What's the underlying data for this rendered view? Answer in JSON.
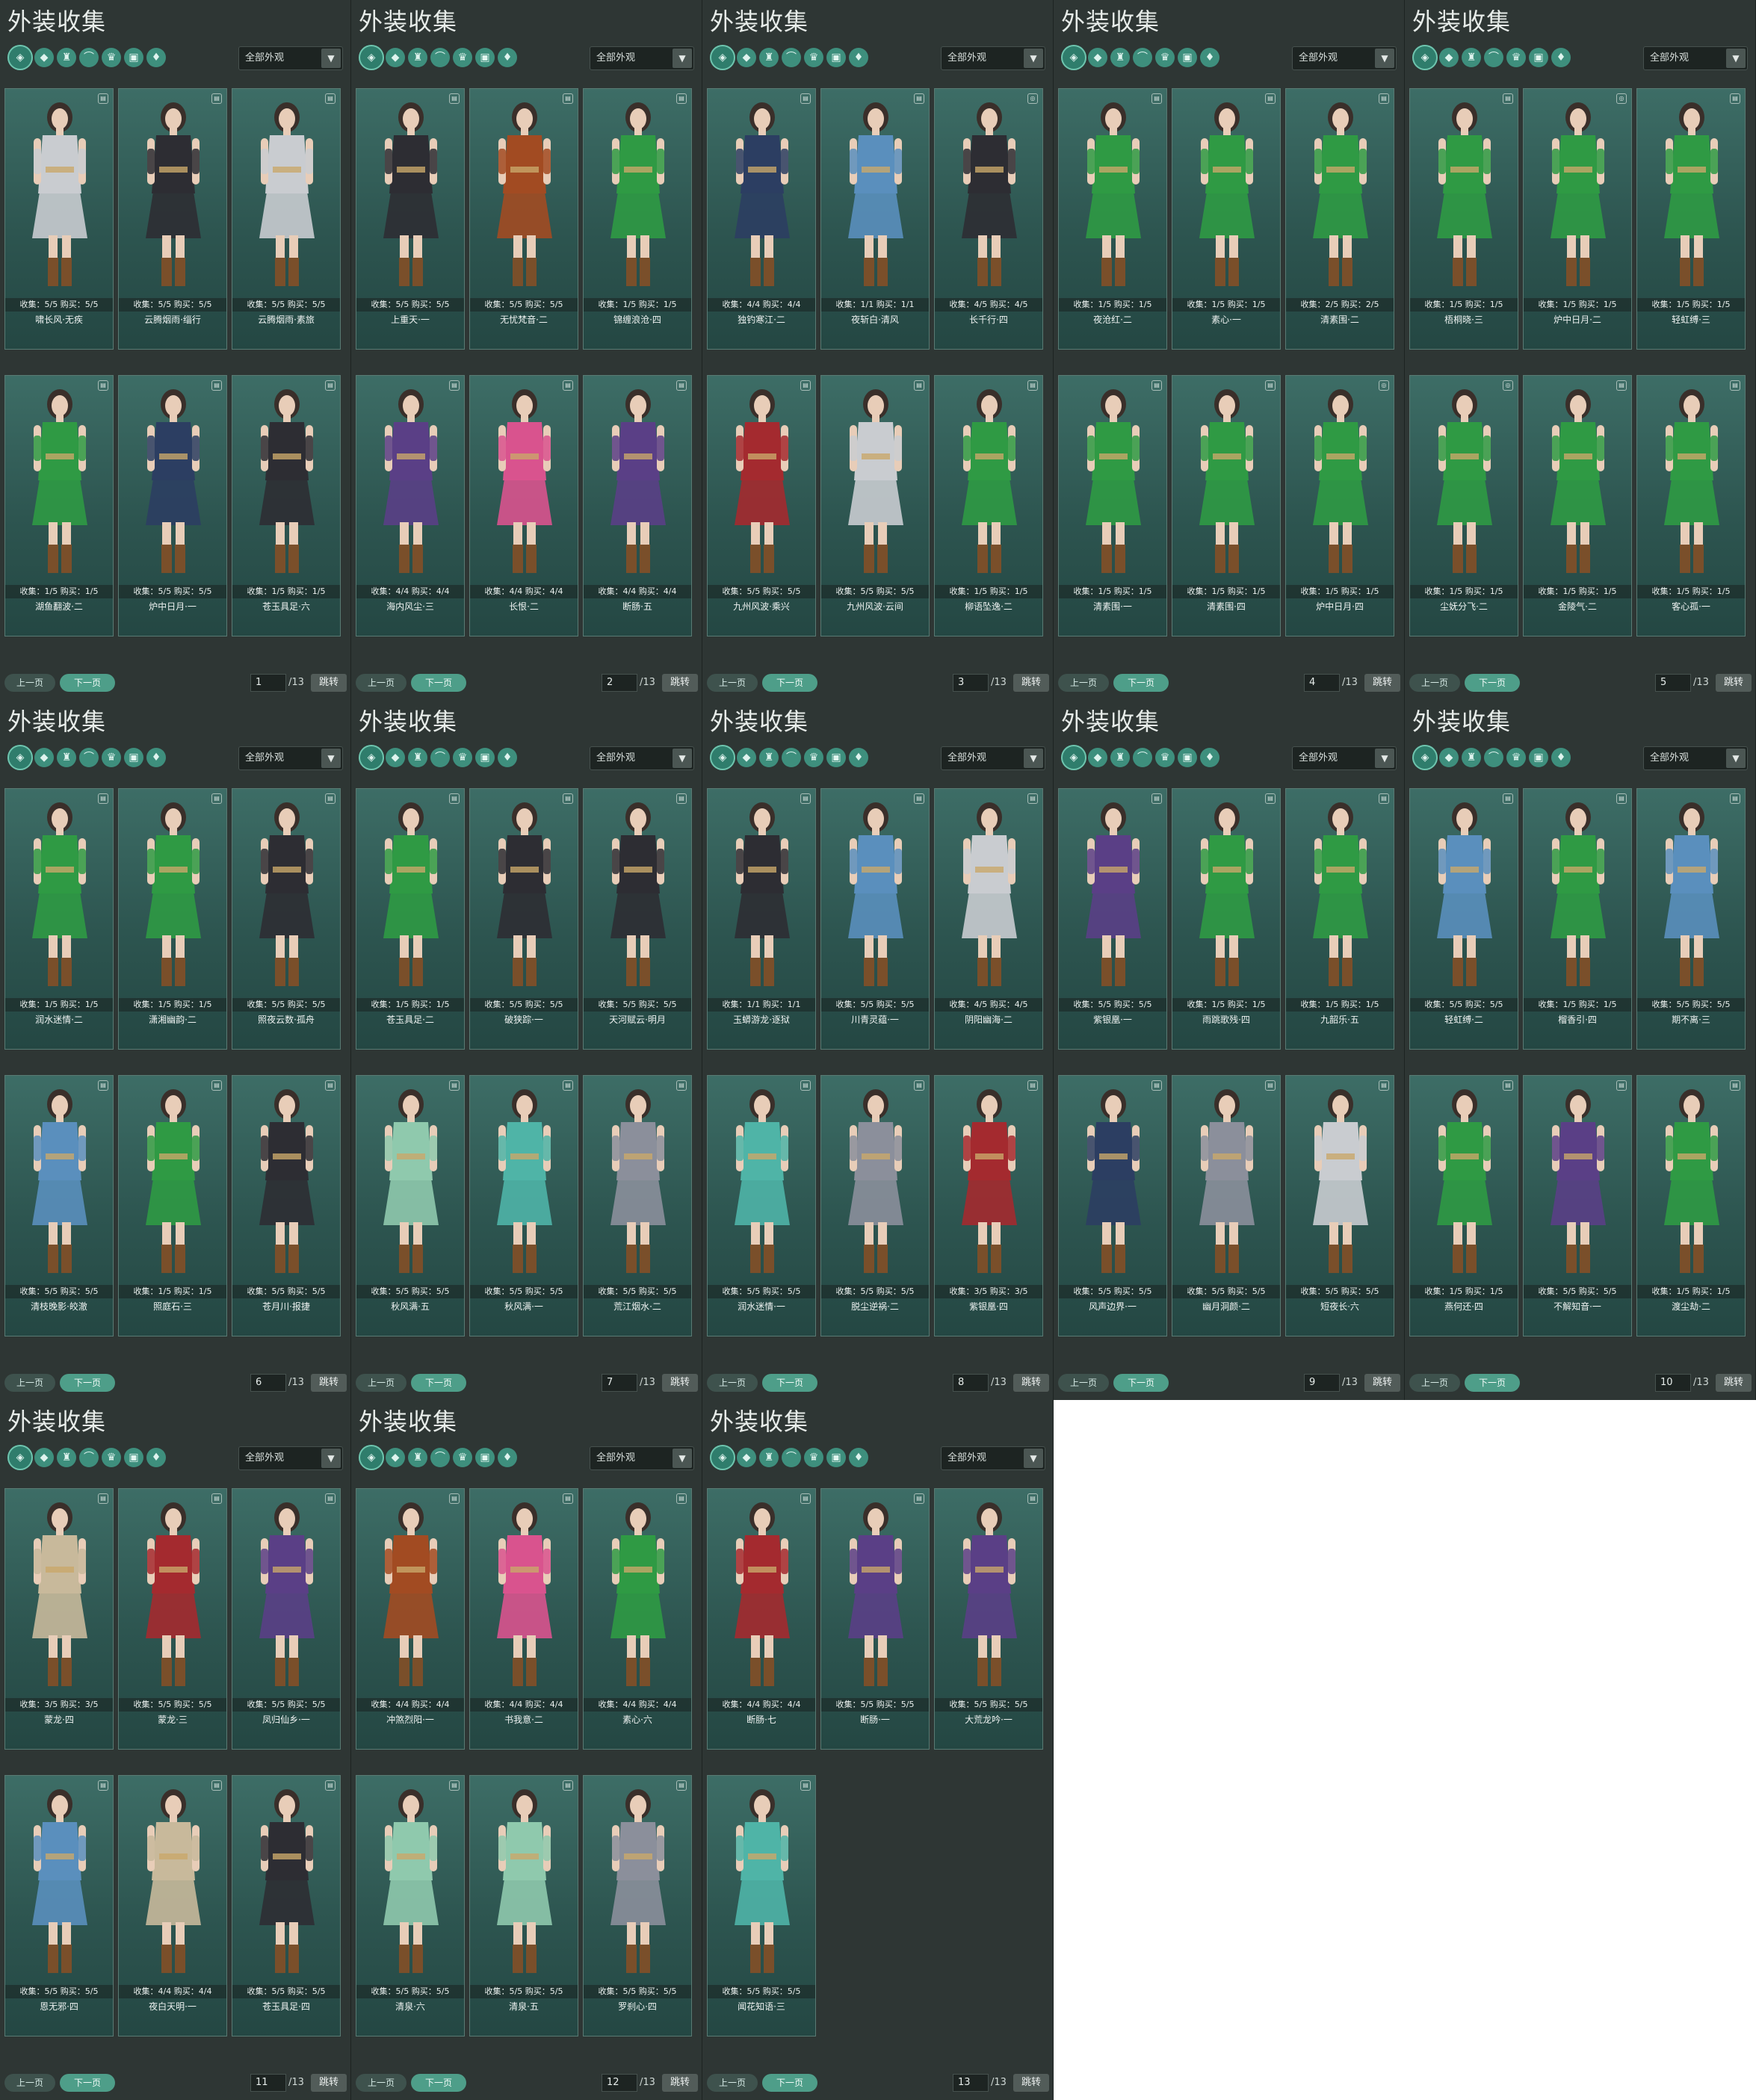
{
  "panel_title": "外装收集",
  "filter_label": "全部外观",
  "tab_icons": [
    "coin-tab-icon",
    "outfit-tab-icon",
    "robe-tab-icon",
    "shoes-tab-icon",
    "hair-tab-icon",
    "mask-tab-icon",
    "weapon-tab-icon"
  ],
  "prev_label": "上一页",
  "next_label": "下一页",
  "jump_label": "跳转",
  "total_pages": "/13",
  "collect_prefix": "收集",
  "buy_prefix": "购买",
  "panels": [
    {
      "page": "1",
      "cards": [
        {
          "name": "啸长风·无疾",
          "collect": "5/5",
          "buy": "5/5",
          "outfit": "white",
          "icon": "gift"
        },
        {
          "name": "云腾烟雨·缁行",
          "collect": "5/5",
          "buy": "5/5",
          "outfit": "dark",
          "icon": "gift"
        },
        {
          "name": "云腾烟雨·素旅",
          "collect": "5/5",
          "buy": "5/5",
          "outfit": "white",
          "icon": "gift"
        },
        {
          "name": "湖鱼翻波·二",
          "collect": "1/5",
          "buy": "1/5",
          "outfit": "green",
          "icon": "gift"
        },
        {
          "name": "炉中日月·一",
          "collect": "5/5",
          "buy": "5/5",
          "outfit": "navy",
          "icon": "gift"
        },
        {
          "name": "苍玉具足·六",
          "collect": "1/5",
          "buy": "1/5",
          "outfit": "dark",
          "icon": "gift"
        }
      ]
    },
    {
      "page": "2",
      "cards": [
        {
          "name": "上重天·一",
          "collect": "5/5",
          "buy": "5/5",
          "outfit": "dark",
          "icon": "gift"
        },
        {
          "name": "无忧梵音·二",
          "collect": "5/5",
          "buy": "5/5",
          "outfit": "orange",
          "icon": "gift"
        },
        {
          "name": "锦缠浪沧·四",
          "collect": "1/5",
          "buy": "1/5",
          "outfit": "green",
          "icon": "gift"
        },
        {
          "name": "海内风尘·三",
          "collect": "4/4",
          "buy": "4/4",
          "outfit": "purple",
          "icon": "gift"
        },
        {
          "name": "长恨·二",
          "collect": "4/4",
          "buy": "4/4",
          "outfit": "pink",
          "icon": "gift"
        },
        {
          "name": "断肠·五",
          "collect": "4/4",
          "buy": "4/4",
          "outfit": "purple",
          "icon": "gift"
        }
      ]
    },
    {
      "page": "3",
      "cards": [
        {
          "name": "独钓寒江·二",
          "collect": "4/4",
          "buy": "4/4",
          "outfit": "navy",
          "icon": "gift"
        },
        {
          "name": "夜斩白·清风",
          "collect": "1/1",
          "buy": "1/1",
          "outfit": "blue",
          "icon": "gift"
        },
        {
          "name": "长千行·四",
          "collect": "4/5",
          "buy": "4/5",
          "outfit": "dark",
          "icon": "lock"
        },
        {
          "name": "九州风波·乘兴",
          "collect": "5/5",
          "buy": "5/5",
          "outfit": "red",
          "icon": "gift"
        },
        {
          "name": "九州风波·云间",
          "collect": "5/5",
          "buy": "5/5",
          "outfit": "white",
          "icon": "gift"
        },
        {
          "name": "柳语坠逸·二",
          "collect": "1/5",
          "buy": "1/5",
          "outfit": "green",
          "icon": "gift"
        }
      ]
    },
    {
      "page": "4",
      "cards": [
        {
          "name": "夜沧红·二",
          "collect": "1/5",
          "buy": "1/5",
          "outfit": "green",
          "icon": "gift"
        },
        {
          "name": "素心·一",
          "collect": "1/5",
          "buy": "1/5",
          "outfit": "green",
          "icon": "gift"
        },
        {
          "name": "清素围·二",
          "collect": "2/5",
          "buy": "2/5",
          "outfit": "green",
          "icon": "gift"
        },
        {
          "name": "清素围·一",
          "collect": "1/5",
          "buy": "1/5",
          "outfit": "green",
          "icon": "gift"
        },
        {
          "name": "清素围·四",
          "collect": "1/5",
          "buy": "1/5",
          "outfit": "green",
          "icon": "gift"
        },
        {
          "name": "炉中日月·四",
          "collect": "1/5",
          "buy": "1/5",
          "outfit": "green",
          "icon": "lock"
        }
      ]
    },
    {
      "page": "5",
      "cards": [
        {
          "name": "梧桐晓·三",
          "collect": "1/5",
          "buy": "1/5",
          "outfit": "green",
          "icon": "gift"
        },
        {
          "name": "炉中日月·二",
          "collect": "1/5",
          "buy": "1/5",
          "outfit": "green",
          "icon": "lock"
        },
        {
          "name": "轻虹缚·三",
          "collect": "1/5",
          "buy": "1/5",
          "outfit": "green",
          "icon": "gift"
        },
        {
          "name": "尘妩分飞·二",
          "collect": "1/5",
          "buy": "1/5",
          "outfit": "green",
          "icon": "lock"
        },
        {
          "name": "金陵气·二",
          "collect": "1/5",
          "buy": "1/5",
          "outfit": "green",
          "icon": "gift"
        },
        {
          "name": "客心孤·一",
          "collect": "1/5",
          "buy": "1/5",
          "outfit": "green",
          "icon": "gift"
        }
      ]
    },
    {
      "page": "6",
      "cards": [
        {
          "name": "润水迷情·二",
          "collect": "1/5",
          "buy": "1/5",
          "outfit": "green",
          "icon": "gift"
        },
        {
          "name": "潇湘幽韵·二",
          "collect": "1/5",
          "buy": "1/5",
          "outfit": "green",
          "icon": "gift"
        },
        {
          "name": "照夜云数·孤舟",
          "collect": "5/5",
          "buy": "5/5",
          "outfit": "dark",
          "icon": "gift"
        },
        {
          "name": "清枝晚影·皎澈",
          "collect": "5/5",
          "buy": "5/5",
          "outfit": "blue",
          "icon": "gift"
        },
        {
          "name": "照庭石·三",
          "collect": "1/5",
          "buy": "1/5",
          "outfit": "green",
          "icon": "gift"
        },
        {
          "name": "苍月川·报捷",
          "collect": "5/5",
          "buy": "5/5",
          "outfit": "dark",
          "icon": "gift"
        }
      ]
    },
    {
      "page": "7",
      "cards": [
        {
          "name": "苍玉具足·二",
          "collect": "1/5",
          "buy": "1/5",
          "outfit": "green",
          "icon": "gift"
        },
        {
          "name": "破狭踪·一",
          "collect": "5/5",
          "buy": "5/5",
          "outfit": "dark",
          "icon": "gift"
        },
        {
          "name": "天河赋云·明月",
          "collect": "5/5",
          "buy": "5/5",
          "outfit": "dark",
          "icon": "gift"
        },
        {
          "name": "秋风满·五",
          "collect": "5/5",
          "buy": "5/5",
          "outfit": "mint",
          "icon": "gift"
        },
        {
          "name": "秋风满·一",
          "collect": "5/5",
          "buy": "5/5",
          "outfit": "teal",
          "icon": "gift"
        },
        {
          "name": "荒江烟水·二",
          "collect": "5/5",
          "buy": "5/5",
          "outfit": "grey",
          "icon": "gift"
        }
      ]
    },
    {
      "page": "8",
      "cards": [
        {
          "name": "玉蟒游龙·逐狱",
          "collect": "1/1",
          "buy": "1/1",
          "outfit": "dark",
          "icon": "gift"
        },
        {
          "name": "川青灵蕴·一",
          "collect": "5/5",
          "buy": "5/5",
          "outfit": "blue",
          "icon": "gift"
        },
        {
          "name": "阴阳幽海·二",
          "collect": "4/5",
          "buy": "4/5",
          "outfit": "white",
          "icon": "gift"
        },
        {
          "name": "润水迷情·一",
          "collect": "5/5",
          "buy": "5/5",
          "outfit": "teal",
          "icon": "gift"
        },
        {
          "name": "脱尘逆祸·二",
          "collect": "5/5",
          "buy": "5/5",
          "outfit": "grey",
          "icon": "gift"
        },
        {
          "name": "紫银凰·四",
          "collect": "3/5",
          "buy": "3/5",
          "outfit": "red",
          "icon": "gift"
        }
      ]
    },
    {
      "page": "9",
      "cards": [
        {
          "name": "紫银凰·一",
          "collect": "5/5",
          "buy": "5/5",
          "outfit": "purple",
          "icon": "gift"
        },
        {
          "name": "雨跳歌残·四",
          "collect": "1/5",
          "buy": "1/5",
          "outfit": "green",
          "icon": "gift"
        },
        {
          "name": "九韶乐·五",
          "collect": "1/5",
          "buy": "1/5",
          "outfit": "green",
          "icon": "gift"
        },
        {
          "name": "风声边界·一",
          "collect": "5/5",
          "buy": "5/5",
          "outfit": "navy",
          "icon": "gift"
        },
        {
          "name": "幽月洞颜·二",
          "collect": "5/5",
          "buy": "5/5",
          "outfit": "grey",
          "icon": "gift"
        },
        {
          "name": "短夜长·六",
          "collect": "5/5",
          "buy": "5/5",
          "outfit": "white",
          "icon": "gift"
        }
      ]
    },
    {
      "page": "10",
      "cards": [
        {
          "name": "轻虹缚·二",
          "collect": "5/5",
          "buy": "5/5",
          "outfit": "blue",
          "icon": "gift"
        },
        {
          "name": "榴香引·四",
          "collect": "1/5",
          "buy": "1/5",
          "outfit": "green",
          "icon": "gift"
        },
        {
          "name": "期不离·三",
          "collect": "5/5",
          "buy": "5/5",
          "outfit": "blue",
          "icon": "gift"
        },
        {
          "name": "燕何还·四",
          "collect": "1/5",
          "buy": "1/5",
          "outfit": "green",
          "icon": "gift"
        },
        {
          "name": "不解知音·一",
          "collect": "5/5",
          "buy": "5/5",
          "outfit": "purple",
          "icon": "gift"
        },
        {
          "name": "渡尘劫·二",
          "collect": "1/5",
          "buy": "1/5",
          "outfit": "green",
          "icon": "gift"
        }
      ]
    },
    {
      "page": "11",
      "cards": [
        {
          "name": "蒙龙·四",
          "collect": "3/5",
          "buy": "3/5",
          "outfit": "cream",
          "icon": "gift"
        },
        {
          "name": "蒙龙·三",
          "collect": "5/5",
          "buy": "5/5",
          "outfit": "red",
          "icon": "gift"
        },
        {
          "name": "凤归仙乡·一",
          "collect": "5/5",
          "buy": "5/5",
          "outfit": "purple",
          "icon": "gift"
        },
        {
          "name": "恩无邪·四",
          "collect": "5/5",
          "buy": "5/5",
          "outfit": "blue",
          "icon": "gift"
        },
        {
          "name": "夜白天明·一",
          "collect": "4/4",
          "buy": "4/4",
          "outfit": "cream",
          "icon": "gift"
        },
        {
          "name": "苍玉具足·四",
          "collect": "5/5",
          "buy": "5/5",
          "outfit": "dark",
          "icon": "gift"
        }
      ]
    },
    {
      "page": "12",
      "cards": [
        {
          "name": "冲煞烈阳·一",
          "collect": "4/4",
          "buy": "4/4",
          "outfit": "orange",
          "icon": "gift"
        },
        {
          "name": "书我意·二",
          "collect": "4/4",
          "buy": "4/4",
          "outfit": "pink",
          "icon": "gift"
        },
        {
          "name": "素心·六",
          "collect": "4/4",
          "buy": "4/4",
          "outfit": "green",
          "icon": "gift"
        },
        {
          "name": "清泉·六",
          "collect": "5/5",
          "buy": "5/5",
          "outfit": "mint",
          "icon": "gift"
        },
        {
          "name": "清泉·五",
          "collect": "5/5",
          "buy": "5/5",
          "outfit": "mint",
          "icon": "gift"
        },
        {
          "name": "罗刹心·四",
          "collect": "5/5",
          "buy": "5/5",
          "outfit": "grey",
          "icon": "gift"
        }
      ]
    },
    {
      "page": "13",
      "cards": [
        {
          "name": "断肠·七",
          "collect": "4/4",
          "buy": "4/4",
          "outfit": "red",
          "icon": "gift"
        },
        {
          "name": "断肠·一",
          "collect": "5/5",
          "buy": "5/5",
          "outfit": "purple",
          "icon": "gift"
        },
        {
          "name": "大荒龙吟·一",
          "collect": "5/5",
          "buy": "5/5",
          "outfit": "purple",
          "icon": "gift"
        },
        {
          "name": "闻花知语·三",
          "collect": "5/5",
          "buy": "5/5",
          "outfit": "teal",
          "icon": "gift"
        }
      ]
    }
  ],
  "colors": {
    "panel_bg": "#2e3634",
    "card_top": "#3d6d66",
    "card_bottom": "#244743",
    "accent": "#4e9e89",
    "outfits": {
      "green": "#2f9a44",
      "white": "#c9ccd0",
      "dark": "#2d2d33",
      "navy": "#2c3e62",
      "orange": "#a24b22",
      "purple": "#5a3f86",
      "pink": "#d9538e",
      "blue": "#5a8fbd",
      "red": "#a42a2f",
      "mint": "#8fc9ad",
      "teal": "#4fb4a7",
      "grey": "#8b8f9b",
      "cream": "#c8b99b"
    }
  }
}
